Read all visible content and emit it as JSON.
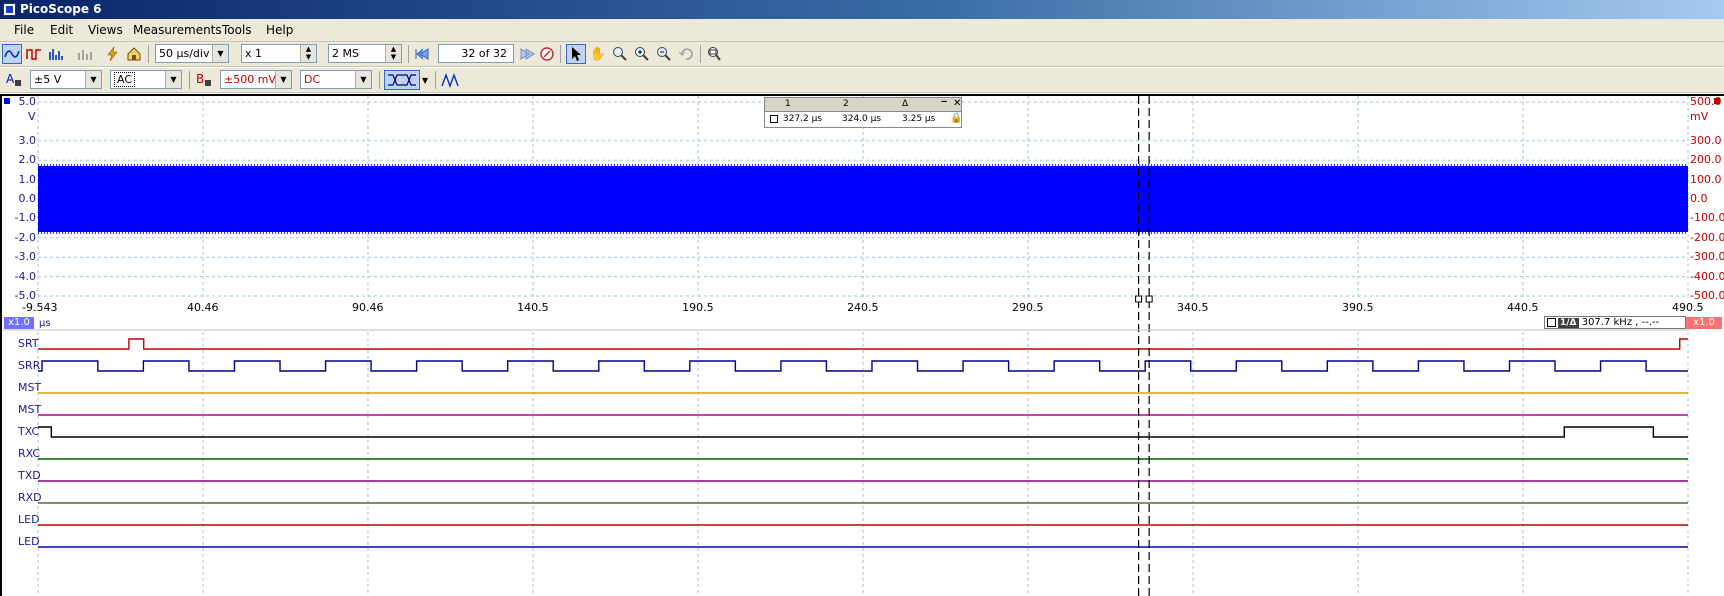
{
  "window": {
    "title": "PicoScope 6"
  },
  "menu": [
    "File",
    "Edit",
    "Views",
    "Measurements",
    "Tools",
    "Help"
  ],
  "toolbar": {
    "timebase": "50 µs/div",
    "zoom": "x 1",
    "samples": "2 MS",
    "buffer": {
      "current": "32",
      "of_label": "of 32"
    }
  },
  "channel_a": {
    "letter": "A",
    "range": "±5 V",
    "coupling": "AC",
    "color": "#0000ff"
  },
  "channel_b": {
    "letter": "B",
    "range": "±500 mV",
    "coupling": "DC",
    "color": "#c00000"
  },
  "chart_data": {
    "type": "line",
    "x_unit": "µs",
    "x_ticks": [
      "-9.543",
      "40.46",
      "90.46",
      "140.5",
      "190.5",
      "240.5",
      "290.5",
      "340.5",
      "390.5",
      "440.5",
      "490.5"
    ],
    "xlim": [
      -9.543,
      490.5
    ],
    "left_axis": {
      "unit": "V",
      "ticks": [
        "5.0",
        "3.0",
        "2.0",
        "1.0",
        "0.0",
        "-1.0",
        "-2.0",
        "-3.0",
        "-4.0",
        "-5.0"
      ],
      "ylim": [
        -5.0,
        5.0
      ]
    },
    "right_axis": {
      "unit": "mV",
      "ticks": [
        "500.0",
        "300.0",
        "200.0",
        "100.0",
        "0.0",
        "-100.0",
        "-200.0",
        "-300.0",
        "-400.0",
        "-500.0"
      ],
      "ylim": [
        -500,
        500
      ]
    },
    "series": [
      {
        "name": "A",
        "color": "#0000ff",
        "band": [
          -1.7,
          1.7
        ]
      }
    ],
    "rulers_us": [
      324.0,
      327.2
    ]
  },
  "measurements": {
    "headers": [
      "1",
      "2",
      "Δ"
    ],
    "values": [
      "327.2 µs",
      "324.0 µs",
      "3.25 µs"
    ]
  },
  "frequency": {
    "label": "1/Δ",
    "value": "307.7 kHz , --.--"
  },
  "zoom_left": "x1.0",
  "zoom_right": "x1.0",
  "axis_unit_bottom": "µs",
  "digital": {
    "channels": [
      {
        "name": "SRT",
        "color": "#c00000"
      },
      {
        "name": "SRR",
        "color": "#00008b"
      },
      {
        "name": "MST",
        "color": "#d4a000"
      },
      {
        "name": "MST",
        "color": "#c0008c"
      },
      {
        "name": "TXC",
        "color": "#000000"
      },
      {
        "name": "RXC",
        "color": "#006400"
      },
      {
        "name": "TXD",
        "color": "#800080"
      },
      {
        "name": "RXD",
        "color": "#556b2f"
      },
      {
        "name": "LED",
        "color": "#c00000"
      },
      {
        "name": "LED",
        "color": "#0000c0"
      }
    ]
  }
}
